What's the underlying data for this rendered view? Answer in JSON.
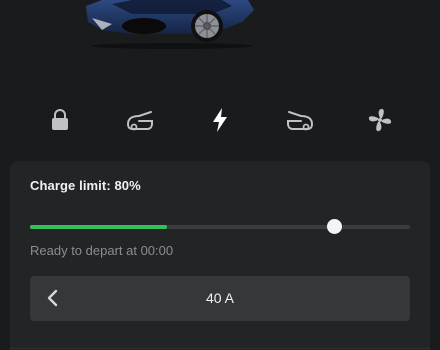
{
  "vehicle": {
    "image": "car-image",
    "color": "#1f3560"
  },
  "controls": [
    {
      "id": "lock",
      "icon": "lock-icon",
      "active": false
    },
    {
      "id": "frunk",
      "icon": "frunk-icon",
      "active": false
    },
    {
      "id": "charge",
      "icon": "lightning-icon",
      "active": true
    },
    {
      "id": "trunk",
      "icon": "trunk-icon",
      "active": false
    },
    {
      "id": "climate",
      "icon": "fan-icon",
      "active": false
    }
  ],
  "charge": {
    "limit_label": "Charge limit: 80%",
    "current_level": 0.36,
    "limit_level": 0.8,
    "ready_text": "Ready to depart at 00:00",
    "amps_value": "40 A",
    "accent_color": "#2fc25b"
  }
}
